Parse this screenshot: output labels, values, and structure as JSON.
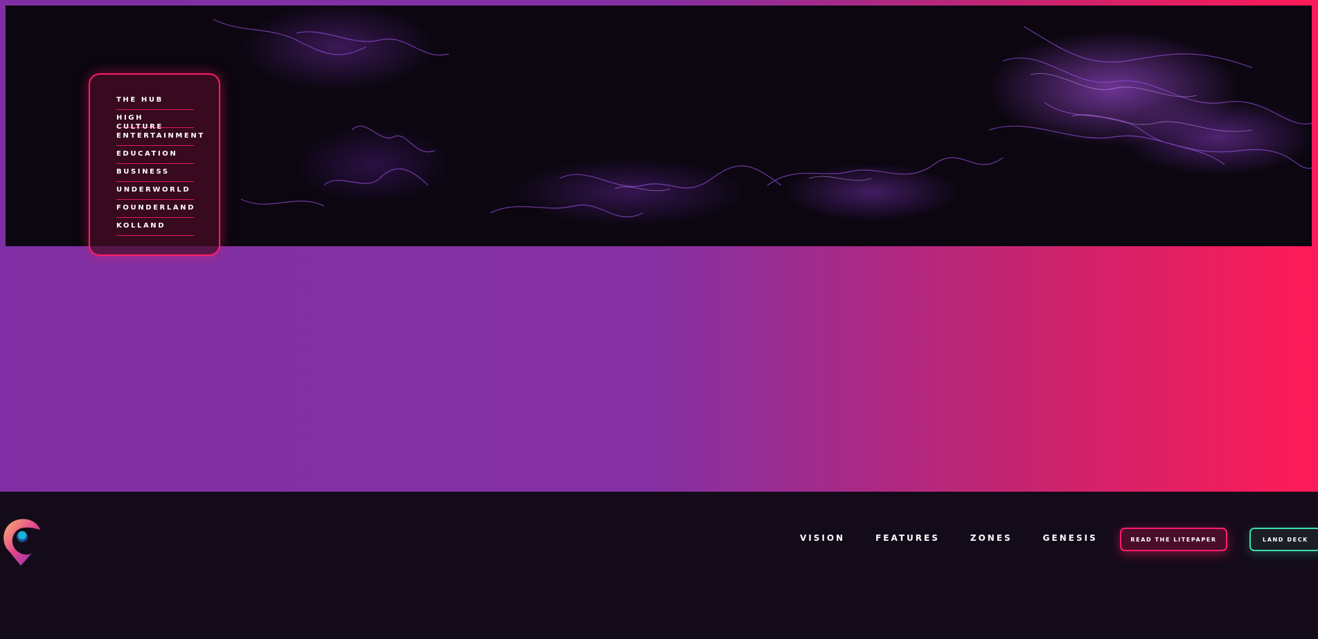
{
  "zone_menu": {
    "items": [
      "THE HUB",
      "HIGH CULTURE",
      "ENTERTAINMENT",
      "EDUCATION",
      "BUSINESS",
      "UNDERWORLD",
      "FOUNDERLAND",
      "KOLLAND"
    ]
  },
  "nav": {
    "links": [
      "VISION",
      "FEATURES",
      "ZONES",
      "GENESIS"
    ]
  },
  "buttons": {
    "litepaper": "READ THE LITEPAPER",
    "deck": "LAND DECK"
  },
  "colors": {
    "accent_pink": "#ff1f67",
    "accent_green": "#3fe0a8",
    "gradient_start": "#7f2fa3",
    "gradient_end": "#ff1a57",
    "background_dark": "#140b1a"
  }
}
